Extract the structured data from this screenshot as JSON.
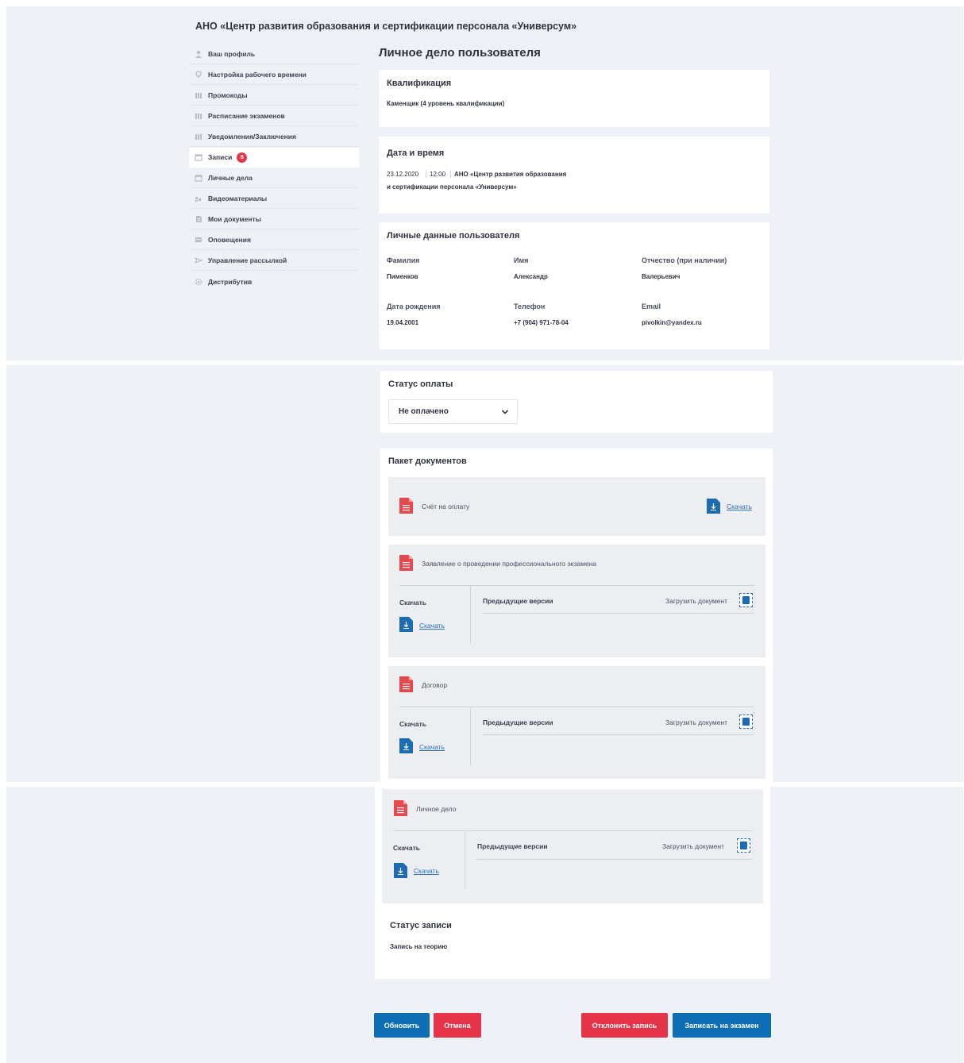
{
  "org_title": "АНО «Центр развития образования и сертификации персонала «Универсум»",
  "page_title": "Личное дело пользователя",
  "sidebar": {
    "items": [
      {
        "label": "Ваш профиль",
        "icon": "user-icon"
      },
      {
        "label": "Настройка рабочего времени",
        "icon": "location-icon"
      },
      {
        "label": "Промокоды",
        "icon": "grid-icon"
      },
      {
        "label": "Расписание экзаменов",
        "icon": "grid-icon"
      },
      {
        "label": "Уведомления/Заключения",
        "icon": "grid-icon"
      },
      {
        "label": "Записи",
        "icon": "calendar-icon",
        "badge": "8",
        "active": true
      },
      {
        "label": "Личные дела",
        "icon": "calendar-icon"
      },
      {
        "label": "Видеоматериалы",
        "icon": "video-icon"
      },
      {
        "label": "Мои документы",
        "icon": "document-icon"
      },
      {
        "label": "Оповещения",
        "icon": "bell-icon"
      },
      {
        "label": "Управление рассылкой",
        "icon": "send-icon"
      },
      {
        "label": "Дистрибутив",
        "icon": "gear-icon"
      }
    ]
  },
  "qualification": {
    "title": "Квалификация",
    "value": "Каменщик (4 уровень квалификации)"
  },
  "datetime": {
    "title": "Дата и время",
    "date": "23.12.2020",
    "time": "12:00",
    "place_line1": "АНО «Центр развития образования",
    "place_line2": "и сертификации персонала «Универсум»"
  },
  "personal": {
    "title": "Личные данные пользователя",
    "surname_label": "Фамилия",
    "surname": "Пименков",
    "name_label": "Имя",
    "name": "Александр",
    "patronymic_label": "Отчество (при наличии)",
    "patronymic": "Валерьевич",
    "birth_label": "Дата рождения",
    "birth": "19.04.2001",
    "phone_label": "Телефон",
    "phone": "+7 (904) 971-78-04",
    "email_label": "Email",
    "email": "pivolkin@yandex.ru"
  },
  "payment": {
    "title": "Статус оплаты",
    "selected": "Не оплачено"
  },
  "documents": {
    "title": "Пакет документов",
    "invoice": {
      "name": "Счёт на оплату",
      "download": "Скачать"
    },
    "application": {
      "name": "Заявление о проведении профессионального экзамена"
    },
    "contract": {
      "name": "Договор"
    },
    "personal_file": {
      "name": "Личное дело"
    },
    "col_download": "Скачать",
    "col_prev": "Предыдущие версии",
    "upload": "Загрузить документ",
    "download_link": "Скачать"
  },
  "record_status": {
    "title": "Статус записи",
    "value": "Запись на теорию"
  },
  "buttons": {
    "update": "Обновить",
    "cancel": "Отмена",
    "reject": "Отклонить запись",
    "enroll": "Записать на экзамен"
  },
  "colors": {
    "primary": "#0d6eb5",
    "danger": "#e5344a",
    "background": "#eef2f7"
  }
}
